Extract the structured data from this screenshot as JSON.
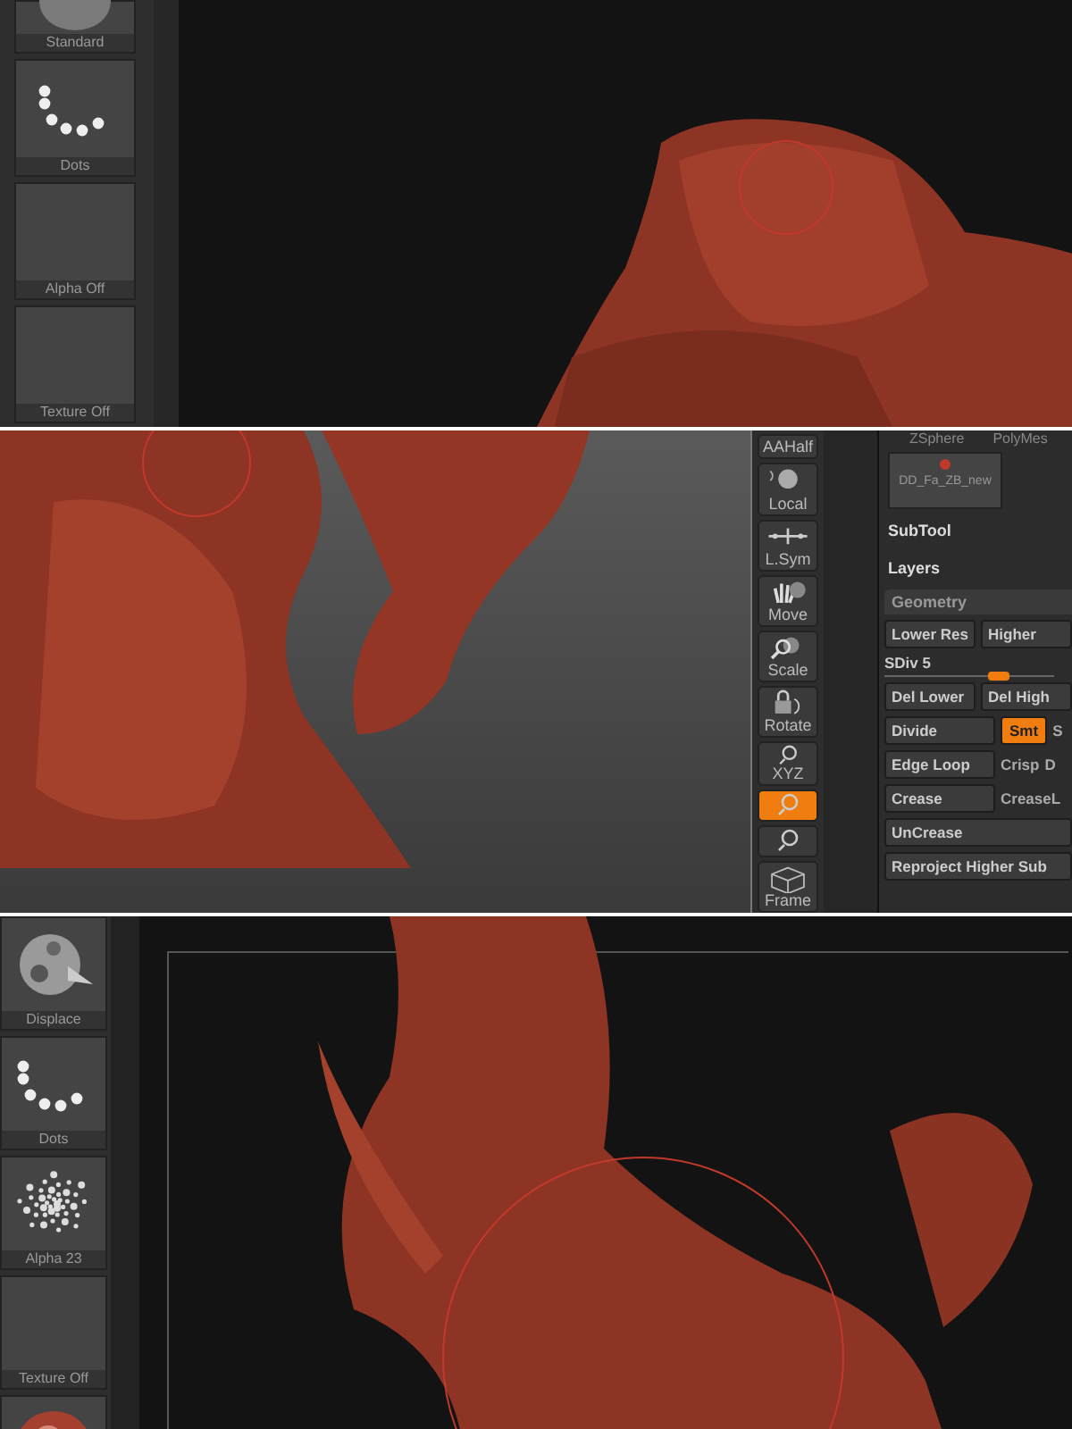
{
  "panels": [
    {
      "kind": "shelf-view",
      "shelf": [
        {
          "label": "Standard",
          "kind": "standard"
        },
        {
          "label": "Dots",
          "kind": "dots"
        },
        {
          "label": "Alpha Off",
          "kind": "empty"
        },
        {
          "label": "Texture Off",
          "kind": "empty"
        }
      ]
    },
    {
      "kind": "tool-view",
      "toolbar": [
        {
          "label": "AAHalf",
          "kind": "text",
          "active": false
        },
        {
          "label": "Local",
          "kind": "sphere",
          "active": false
        },
        {
          "label": "L.Sym",
          "kind": "sym",
          "active": false
        },
        {
          "label": "Move",
          "kind": "hand",
          "active": false
        },
        {
          "label": "Scale",
          "kind": "magnifier",
          "active": false
        },
        {
          "label": "Rotate",
          "kind": "rotate",
          "active": false
        },
        {
          "label": "XYZ",
          "kind": "axis",
          "active": false
        },
        {
          "kind": "axis",
          "active": true
        },
        {
          "kind": "axis",
          "active": false
        },
        {
          "label": "Frame",
          "kind": "cube",
          "active": false
        }
      ],
      "tool_tabs": [
        "ZSphere",
        "PolyMes"
      ],
      "tool_thumb": "DD_Fa_ZB_new",
      "sections": [
        "SubTool",
        "Layers"
      ],
      "geometry": {
        "title": "Geometry",
        "rows": [
          [
            {
              "label": "Lower Res",
              "kind": "button",
              "on": false
            },
            {
              "label": "Higher",
              "kind": "button",
              "on": false
            }
          ],
          [
            {
              "label": "SDiv 5",
              "kind": "slider",
              "level": 0.7
            }
          ],
          [
            {
              "label": "Del Lower",
              "kind": "button",
              "on": false
            },
            {
              "label": "Del High",
              "kind": "button",
              "on": false
            }
          ],
          [
            {
              "label": "Divide",
              "kind": "button",
              "on": false
            },
            {
              "label": "Smt",
              "kind": "toggle",
              "on": true
            },
            {
              "label": "S",
              "kind": "text"
            }
          ],
          [
            {
              "label": "Edge Loop",
              "kind": "button",
              "on": false
            },
            {
              "label": "Crisp",
              "kind": "text"
            },
            {
              "label": "D",
              "kind": "text"
            }
          ],
          [
            {
              "label": "Crease",
              "kind": "button",
              "on": false
            },
            {
              "label": "CreaseL",
              "kind": "text"
            }
          ],
          [
            {
              "label": "UnCrease",
              "kind": "wide",
              "on": false
            }
          ],
          [
            {
              "label": "Reproject Higher Sub",
              "kind": "wide",
              "on": false
            }
          ]
        ]
      }
    },
    {
      "kind": "shelf-view",
      "shelf": [
        {
          "label": "Displace",
          "kind": "displace"
        },
        {
          "label": "Dots",
          "kind": "dots"
        },
        {
          "label": "Alpha 23",
          "kind": "alpha"
        },
        {
          "label": "Texture Off",
          "kind": "empty"
        },
        {
          "kind": "material"
        }
      ]
    }
  ]
}
